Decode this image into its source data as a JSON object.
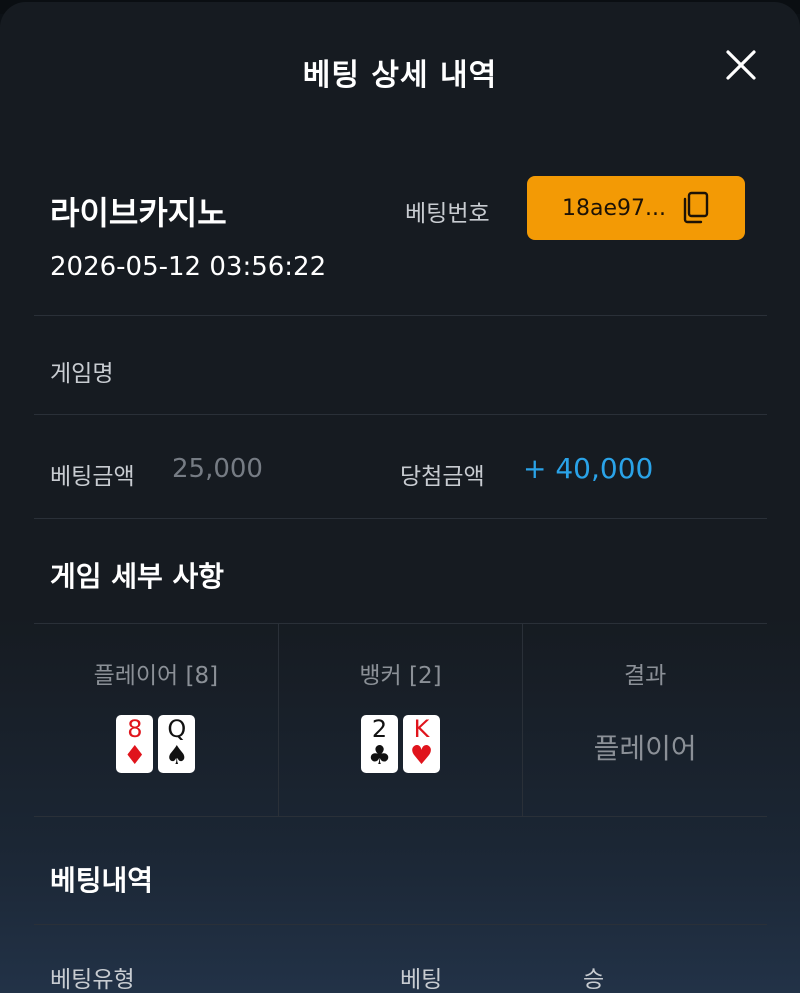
{
  "header": {
    "title": "베팅 상세 내역"
  },
  "summary": {
    "provider": "라이브카지노",
    "datetime": "2026-05-12 03:56:22",
    "bet_number_label": "베팅번호",
    "bet_number_value": "18ae97..."
  },
  "game": {
    "name_label": "게임명"
  },
  "amounts": {
    "bet_label": "베팅금액",
    "bet_value": "25,000",
    "win_label": "당첨금액",
    "win_value": "+ 40,000"
  },
  "details": {
    "title": "게임 세부 사항",
    "player": {
      "header": "플레이어 [8]",
      "cards": [
        {
          "rank": "8",
          "suit": "♦",
          "color": "#e0141c"
        },
        {
          "rank": "Q",
          "suit": "♠",
          "color": "#111111"
        }
      ]
    },
    "banker": {
      "header": "뱅커 [2]",
      "cards": [
        {
          "rank": "2",
          "suit": "♣",
          "color": "#111111"
        },
        {
          "rank": "K",
          "suit": "♥",
          "color": "#e0141c"
        }
      ]
    },
    "result": {
      "header": "결과",
      "value": "플레이어"
    }
  },
  "history": {
    "title": "베팅내역",
    "columns": [
      "베팅유형",
      "베팅",
      "승"
    ]
  },
  "colors": {
    "accent": "#f39a05",
    "win": "#2aa3e8",
    "card_red": "#e0141c",
    "card_black": "#111111"
  },
  "icons": {
    "close": "close-icon",
    "copy": "copy-icon"
  }
}
